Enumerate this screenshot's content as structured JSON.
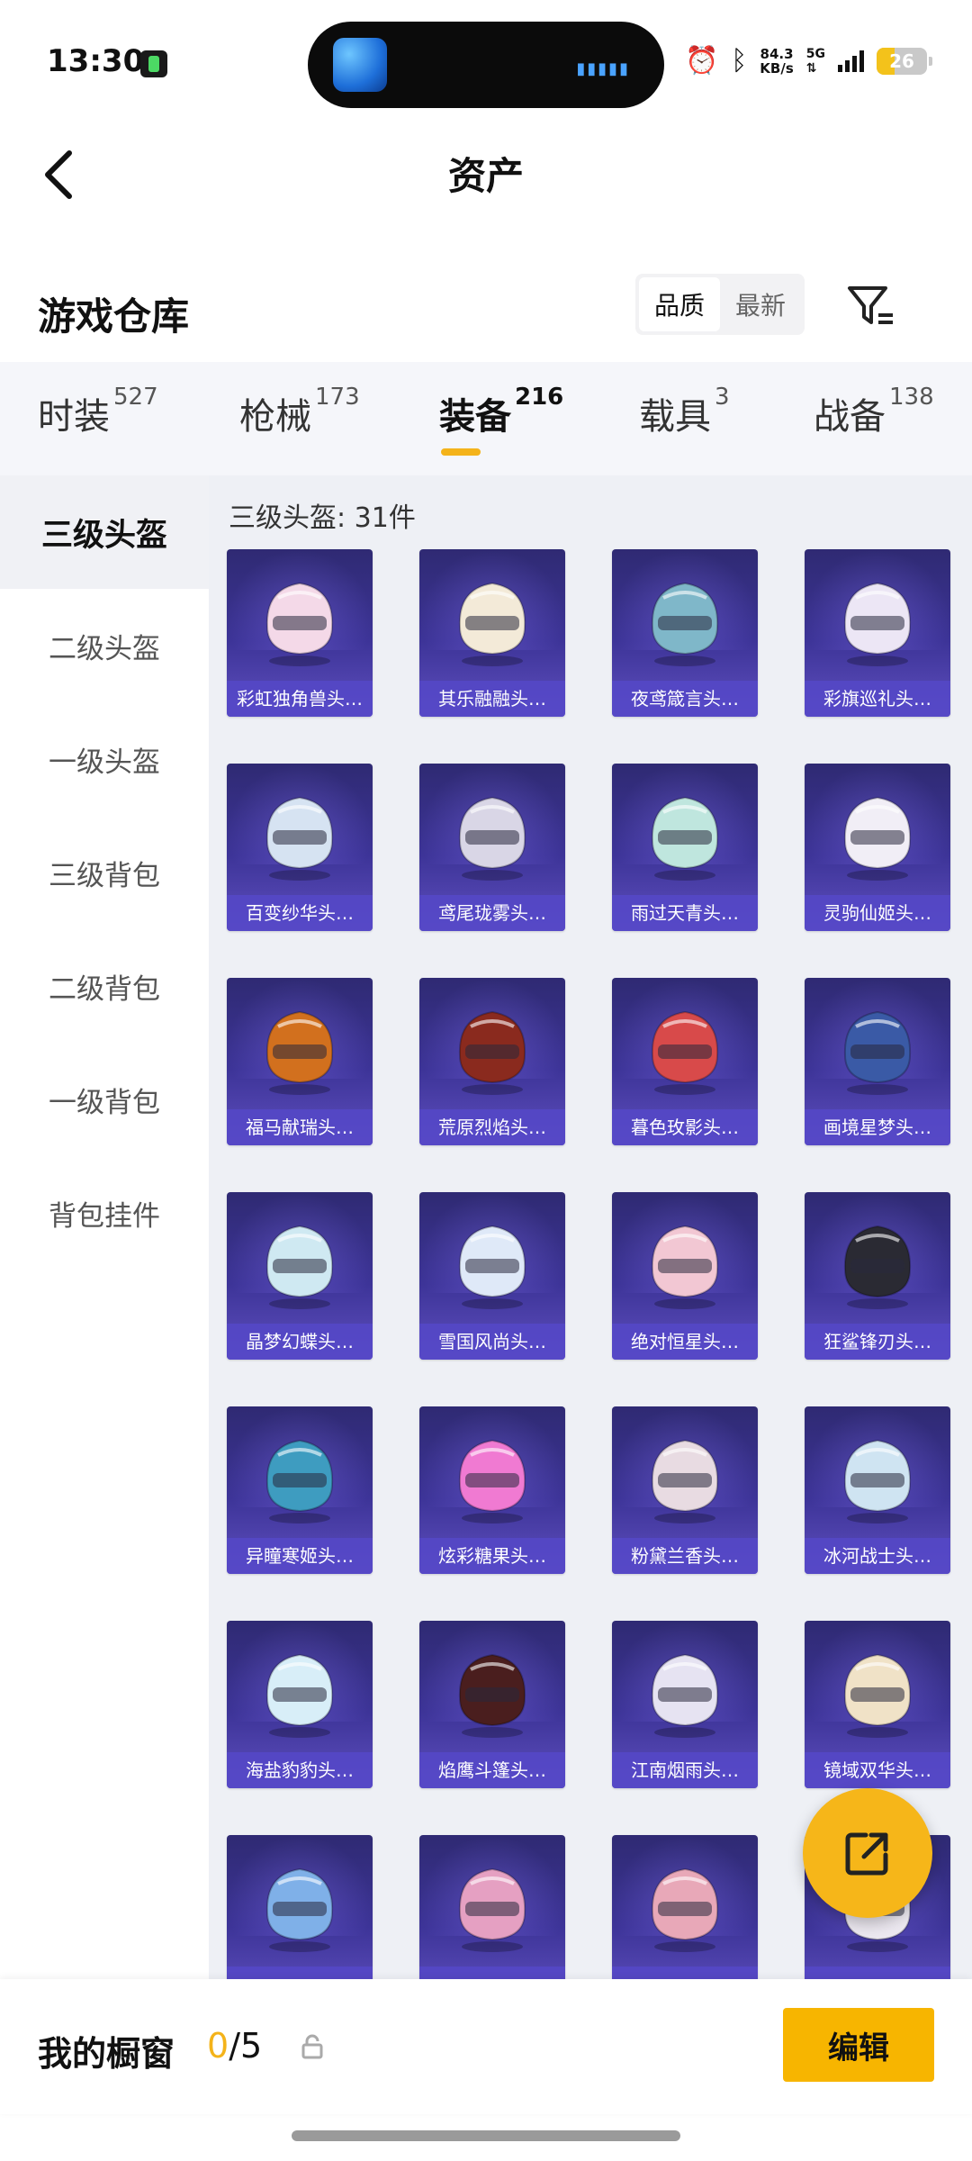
{
  "status_bar": {
    "time": "13:30",
    "net_speed": "84.3",
    "net_speed_unit": "KB/s",
    "network": "5G",
    "battery": "26",
    "icons": [
      "alarm-icon",
      "bluetooth-icon",
      "signal-icon",
      "battery-icon"
    ]
  },
  "header": {
    "title": "资产",
    "back_icon": "chevron-left-icon"
  },
  "warehouse": {
    "title": "游戏仓库",
    "sort_options": [
      "品质",
      "最新"
    ],
    "active_sort": "品质",
    "filter_icon": "filter-icon"
  },
  "tabs": [
    {
      "label": "时装",
      "count": "527"
    },
    {
      "label": "枪械",
      "count": "173"
    },
    {
      "label": "装备",
      "count": "216",
      "active": true
    },
    {
      "label": "载具",
      "count": "3"
    },
    {
      "label": "战备",
      "count": "138"
    }
  ],
  "side_nav": [
    "三级头盔",
    "二级头盔",
    "一级头盔",
    "三级背包",
    "二级背包",
    "一级背包",
    "背包挂件"
  ],
  "active_side": "三级头盔",
  "grid": {
    "heading": "三级头盔: 31件",
    "items": [
      "彩虹独角兽头…",
      "其乐融融头…",
      "夜鸢箴言头…",
      "彩旗巡礼头…",
      "百变纱华头…",
      "鸢尾珑雾头…",
      "雨过天青头…",
      "灵驹仙姬头…",
      "福马献瑞头…",
      "荒原烈焰头…",
      "暮色玫影头…",
      "画境星梦头…",
      "晶梦幻蝶头…",
      "雪国风尚头…",
      "绝对恒星头…",
      "狂鲨锋刃头…",
      "异瞳寒姬头…",
      "炫彩糖果头…",
      "粉黛兰香头…",
      "冰河战士头…",
      "海盐豹豹头…",
      "焰鹰斗篷头…",
      "江南烟雨头…",
      "镜域双华头…",
      "",
      "",
      "",
      ""
    ],
    "helmet_colors": [
      "#f4d9e8",
      "#f3ead8",
      "#7fb7c9",
      "#ece6f5",
      "#d6e3f2",
      "#d9d6e6",
      "#bfe6de",
      "#f1eef6",
      "#d2701e",
      "#8a2a1e",
      "#d84a4a",
      "#3a5aa6",
      "#cfe9f2",
      "#dfe9f8",
      "#f2c7d3",
      "#2a2a33",
      "#3e9cc0",
      "#f07ad2",
      "#e8dbe2",
      "#cfe4f2",
      "#d8eef8",
      "#4a1e1e",
      "#e6e3f2",
      "#f0e2c7",
      "#7fb0e8",
      "#e5a0c2",
      "#e8a8b8",
      "#ece8f0"
    ]
  },
  "share_fab": {
    "icon": "share-icon"
  },
  "bottom_bar": {
    "label": "我的橱窗",
    "used": "0",
    "total": "/5",
    "lock_icon": "lock-icon",
    "edit": "编辑"
  }
}
